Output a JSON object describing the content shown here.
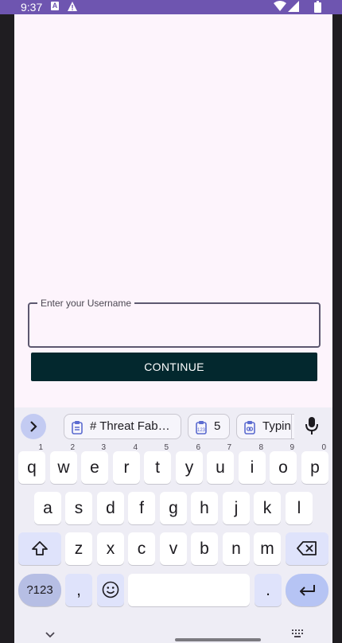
{
  "status_bar": {
    "time": "9:37",
    "notification_a": "A"
  },
  "form": {
    "username_label": "Enter your Username",
    "username_value": "",
    "continue_label": "CONTINUE"
  },
  "keyboard": {
    "suggestions": [
      {
        "icon": "clipboard-icon",
        "text": "# Threat Fab…"
      },
      {
        "icon": "clipboard-numbers-icon",
        "text": "5"
      },
      {
        "icon": "clipboard-link-icon",
        "text": "Typin"
      }
    ],
    "row1": [
      {
        "key": "q",
        "hint": "1"
      },
      {
        "key": "w",
        "hint": "2"
      },
      {
        "key": "e",
        "hint": "3"
      },
      {
        "key": "r",
        "hint": "4"
      },
      {
        "key": "t",
        "hint": "5"
      },
      {
        "key": "y",
        "hint": "6"
      },
      {
        "key": "u",
        "hint": "7"
      },
      {
        "key": "i",
        "hint": "8"
      },
      {
        "key": "o",
        "hint": "9"
      },
      {
        "key": "p",
        "hint": "0"
      }
    ],
    "row2": [
      "a",
      "s",
      "d",
      "f",
      "g",
      "h",
      "j",
      "k",
      "l"
    ],
    "row3": [
      "z",
      "x",
      "c",
      "v",
      "b",
      "n",
      "m"
    ],
    "symbols_label": "?123",
    "comma": ",",
    "period": ".",
    "colors": {
      "accent": "#6e55b0",
      "button": "#03282e",
      "special_key": "#dfe3fb"
    }
  }
}
